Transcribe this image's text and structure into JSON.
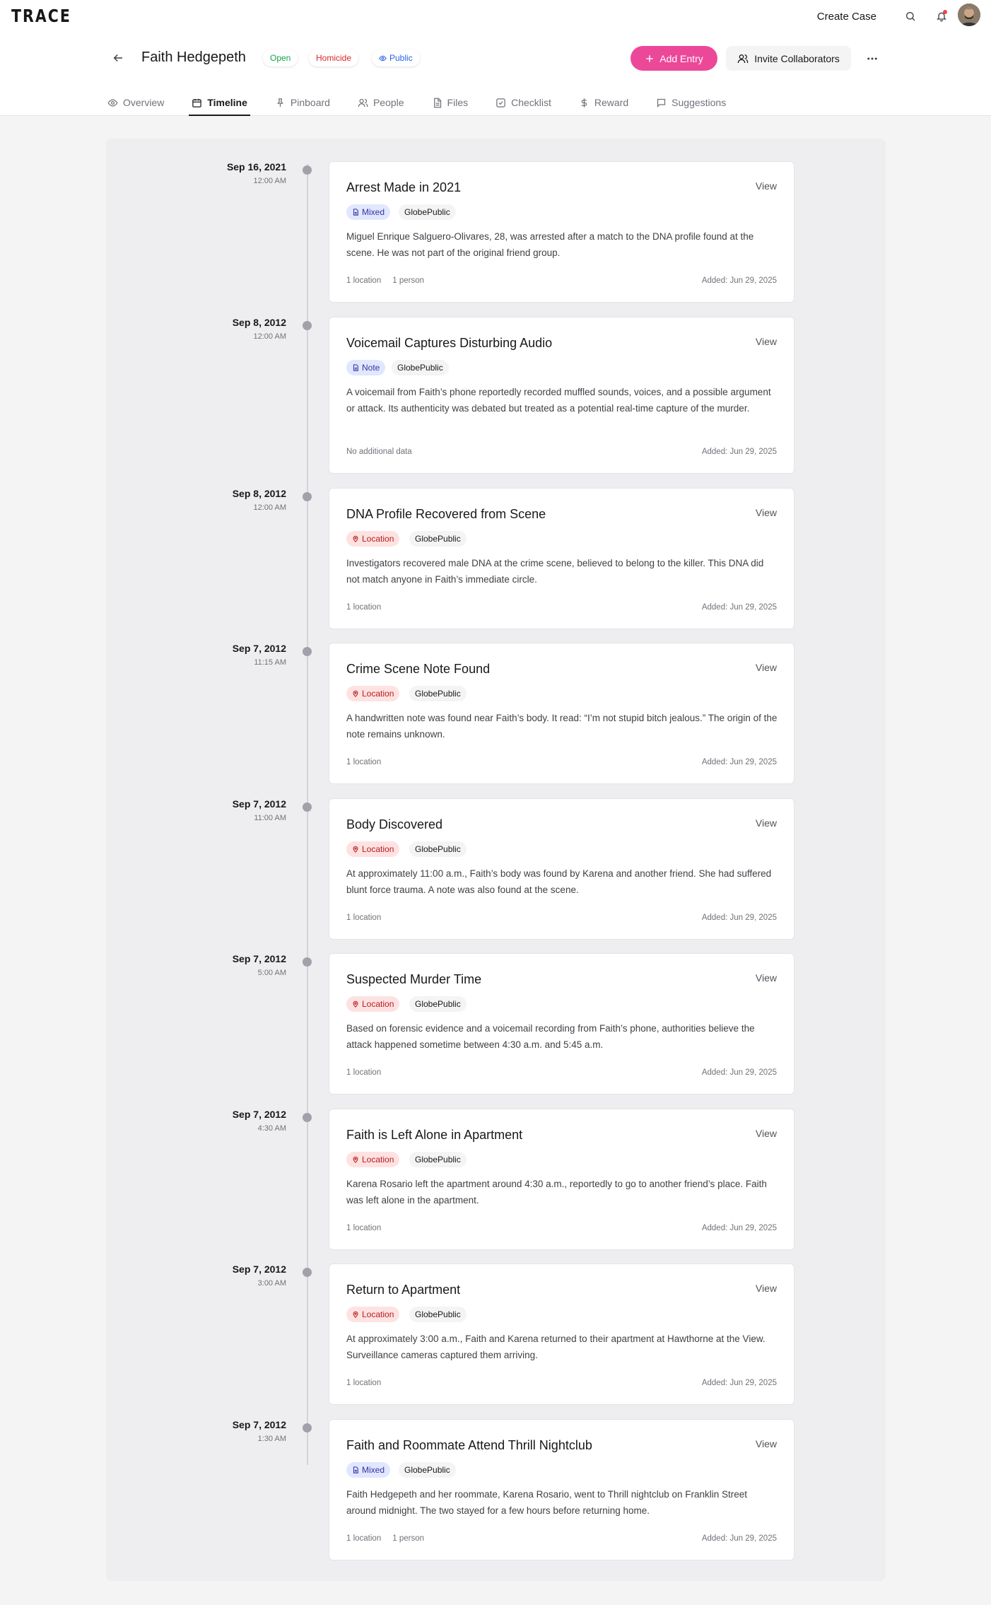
{
  "app": {
    "logo": "TRACE",
    "create_case": "Create Case"
  },
  "case": {
    "name": "Faith Hedgepeth",
    "status": "Open",
    "category": "Homicide",
    "visibility": "Public"
  },
  "actions": {
    "add_entry": "Add Entry",
    "invite": "Invite Collaborators"
  },
  "tabs": [
    "Overview",
    "Timeline",
    "Pinboard",
    "People",
    "Files",
    "Checklist",
    "Reward",
    "Suggestions"
  ],
  "active_tab": "Timeline",
  "colors": {
    "accent": "#ec4899",
    "open": "#16a34a",
    "homicide": "#dc2626",
    "public": "#2563eb"
  },
  "entries": [
    {
      "date": "Sep 16, 2021",
      "time": "12:00 AM",
      "title": "Arrest Made in 2021",
      "type": "Mixed",
      "visibility": "GlobePublic",
      "description": "Miguel Enrique Salguero-Olivares, 28, was arrested after a match to the DNA profile found at the scene. He was not part of the original friend group.",
      "meta": [
        "1 location",
        "1 person"
      ],
      "added": "Added: Jun 29, 2025",
      "view": "View"
    },
    {
      "date": "Sep 8, 2012",
      "time": "12:00 AM",
      "title": "Voicemail Captures Disturbing Audio",
      "type": "Note",
      "visibility": "GlobePublic",
      "description": "A voicemail from Faith’s phone reportedly recorded muffled sounds, voices, and a possible argument or attack. Its authenticity was debated but treated as a potential real-time capture of the murder.",
      "meta": [
        "No additional data"
      ],
      "added": "Added: Jun 29, 2025",
      "view": "View"
    },
    {
      "date": "Sep 8, 2012",
      "time": "12:00 AM",
      "title": "DNA Profile Recovered from Scene",
      "type": "Location",
      "visibility": "GlobePublic",
      "description": "Investigators recovered male DNA at the crime scene, believed to belong to the killer. This DNA did not match anyone in Faith’s immediate circle.",
      "meta": [
        "1 location"
      ],
      "added": "Added: Jun 29, 2025",
      "view": "View"
    },
    {
      "date": "Sep 7, 2012",
      "time": "11:15 AM",
      "title": "Crime Scene Note Found",
      "type": "Location",
      "visibility": "GlobePublic",
      "description": "A handwritten note was found near Faith’s body. It read: “I’m not stupid bitch jealous.” The origin of the note remains unknown.",
      "meta": [
        "1 location"
      ],
      "added": "Added: Jun 29, 2025",
      "view": "View"
    },
    {
      "date": "Sep 7, 2012",
      "time": "11:00 AM",
      "title": "Body Discovered",
      "type": "Location",
      "visibility": "GlobePublic",
      "description": "At approximately 11:00 a.m., Faith’s body was found by Karena and another friend. She had suffered blunt force trauma. A note was also found at the scene.",
      "meta": [
        "1 location"
      ],
      "added": "Added: Jun 29, 2025",
      "view": "View"
    },
    {
      "date": "Sep 7, 2012",
      "time": "5:00 AM",
      "title": "Suspected Murder Time",
      "type": "Location",
      "visibility": "GlobePublic",
      "description": "Based on forensic evidence and a voicemail recording from Faith’s phone, authorities believe the attack happened sometime between 4:30 a.m. and 5:45 a.m.",
      "meta": [
        "1 location"
      ],
      "added": "Added: Jun 29, 2025",
      "view": "View"
    },
    {
      "date": "Sep 7, 2012",
      "time": "4:30 AM",
      "title": "Faith is Left Alone in Apartment",
      "type": "Location",
      "visibility": "GlobePublic",
      "description": "Karena Rosario left the apartment around 4:30 a.m., reportedly to go to another friend’s place. Faith was left alone in the apartment.",
      "meta": [
        "1 location"
      ],
      "added": "Added: Jun 29, 2025",
      "view": "View"
    },
    {
      "date": "Sep 7, 2012",
      "time": "3:00 AM",
      "title": "Return to Apartment",
      "type": "Location",
      "visibility": "GlobePublic",
      "description": "At approximately 3:00 a.m., Faith and Karena returned to their apartment at Hawthorne at the View. Surveillance cameras captured them arriving.",
      "meta": [
        "1 location"
      ],
      "added": "Added: Jun 29, 2025",
      "view": "View"
    },
    {
      "date": "Sep 7, 2012",
      "time": "1:30 AM",
      "title": "Faith and Roommate Attend Thrill Nightclub",
      "type": "Mixed",
      "visibility": "GlobePublic",
      "description": "Faith Hedgepeth and her roommate, Karena Rosario, went to Thrill nightclub on Franklin Street around midnight. The two stayed for a few hours before returning home.",
      "meta": [
        "1 location",
        "1 person"
      ],
      "added": "Added: Jun 29, 2025",
      "view": "View"
    }
  ]
}
